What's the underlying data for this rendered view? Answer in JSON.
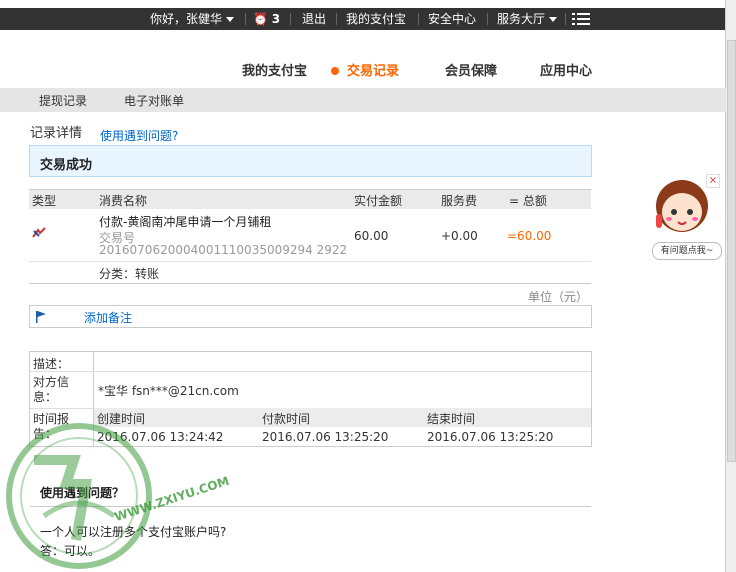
{
  "topbar": {
    "greeting": "你好，张健华",
    "msg_count": "3",
    "logout": "退出",
    "my_alipay": "我的支付宝",
    "security": "安全中心",
    "service": "服务大厅"
  },
  "nav": {
    "items": [
      "我的支付宝",
      "交易记录",
      "会员保障",
      "应用中心"
    ]
  },
  "subnav": {
    "items": [
      "提现记录",
      "电子对账单"
    ]
  },
  "detail": {
    "title": "记录详情",
    "help_link": "使用遇到问题?",
    "status": "交易成功"
  },
  "table": {
    "headers": [
      "类型",
      "消费名称",
      "实付金额",
      "服务费",
      "= 总额"
    ],
    "row": {
      "name": "付款-黄阁南冲尾申请一个月铺租",
      "trade_no_label": "交易号",
      "trade_no": "2016070620004001110035009294 2922",
      "paid": "60.00",
      "fee": "+0.00",
      "total": "=60.00"
    },
    "category": "分类：转账",
    "unit": "单位（元）"
  },
  "note": {
    "add_label": "添加备注"
  },
  "info": {
    "desc_label": "描述：",
    "party_label": "对方信息：",
    "party_value": "*宝华 fsn***@21cn.com",
    "time_label": "时间报告：",
    "time_headers": [
      "创建时间",
      "付款时间",
      "结束时间"
    ],
    "time_values": [
      "2016.07.06 13:24:42",
      "2016.07.06 13:25:20",
      "2016.07.06 13:25:20"
    ]
  },
  "faq": {
    "title": "使用遇到问题？",
    "question": "一个人可以注册多个支付宝账户吗?",
    "answer": "答：可以。"
  },
  "widget": {
    "bubble": "有问题点我~",
    "close": "×"
  },
  "watermark": {
    "text": "WWW.ZXIYU.COM"
  },
  "colors": {
    "accent": "#ff6600",
    "link": "#0066cc",
    "topbar": "#333333",
    "status_bg": "#e8f5ff"
  }
}
